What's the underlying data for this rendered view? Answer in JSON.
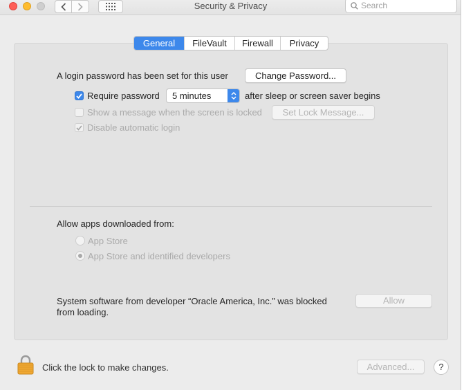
{
  "window": {
    "title": "Security & Privacy",
    "search_placeholder": "Search"
  },
  "tabs": [
    {
      "label": "General",
      "active": true
    },
    {
      "label": "FileVault",
      "active": false
    },
    {
      "label": "Firewall",
      "active": false
    },
    {
      "label": "Privacy",
      "active": false
    }
  ],
  "general": {
    "login_password_text": "A login password has been set for this user",
    "change_password_label": "Change Password...",
    "require_password_label": "Require password",
    "require_password_checked": true,
    "require_password_delay": "5 minutes",
    "after_sleep_text": "after sleep or screen saver begins",
    "show_message_label": "Show a message when the screen is locked",
    "show_message_checked": false,
    "set_lock_message_label": "Set Lock Message...",
    "disable_auto_login_label": "Disable automatic login",
    "disable_auto_login_checked": true
  },
  "allow_apps": {
    "heading": "Allow apps downloaded from:",
    "options": [
      {
        "label": "App Store",
        "selected": false
      },
      {
        "label": "App Store and identified developers",
        "selected": true
      }
    ]
  },
  "blocked": {
    "line1": "System software from developer “Oracle America, Inc.” was blocked",
    "line2": "from loading.",
    "allow_label": "Allow"
  },
  "footer": {
    "lock_text": "Click the lock to make changes.",
    "advanced_label": "Advanced...",
    "help_label": "?"
  },
  "colors": {
    "accent": "#3d88eb",
    "lock_icon": "#f0a832"
  },
  "icons": [
    "chevron-left-icon",
    "chevron-right-icon",
    "grid-icon",
    "search-icon",
    "checkmark-icon",
    "lock-icon"
  ]
}
